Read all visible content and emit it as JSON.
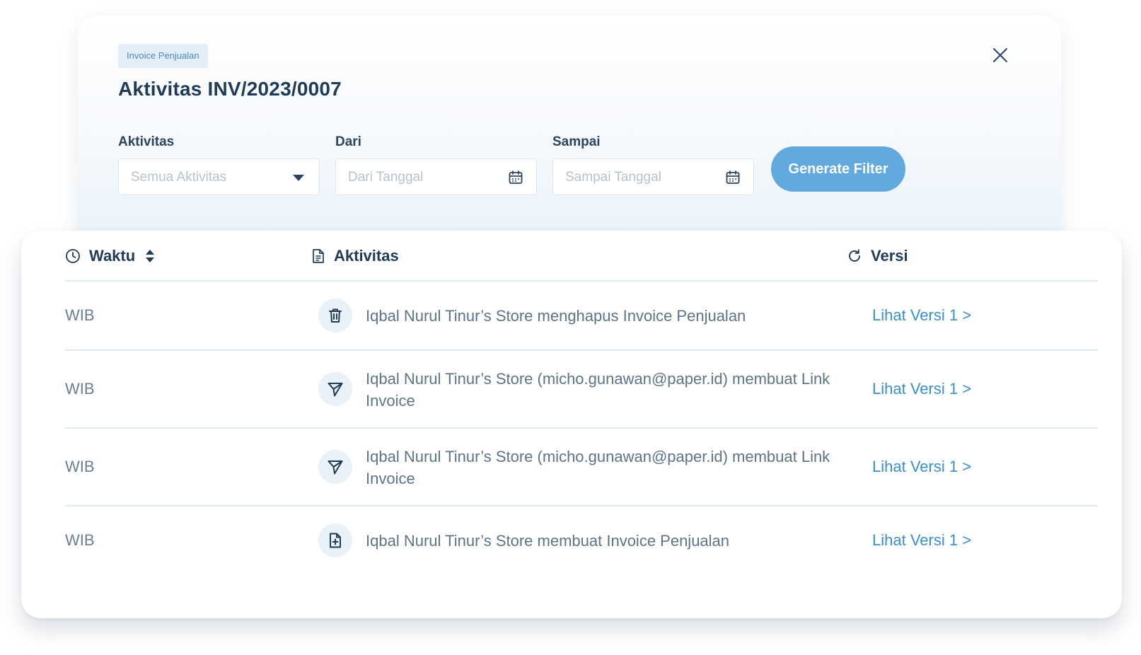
{
  "modal": {
    "badge": "Invoice Penjualan",
    "title": "Aktivitas INV/2023/0007"
  },
  "filters": {
    "activity_label": "Aktivitas",
    "activity_placeholder": "Semua Aktivitas",
    "from_label": "Dari",
    "from_placeholder": "Dari Tanggal",
    "to_label": "Sampai",
    "to_placeholder": "Sampai Tanggal",
    "generate_label": "Generate Filter"
  },
  "table": {
    "headers": {
      "time": "Waktu",
      "activity": "Aktivitas",
      "version": "Versi"
    },
    "rows": [
      {
        "time": "WIB",
        "icon": "trash-icon",
        "text": "Iqbal Nurul Tinur’s Store menghapus Invoice Penjualan",
        "version": "Lihat Versi 1 >"
      },
      {
        "time": "WIB",
        "icon": "send-icon",
        "text": "Iqbal Nurul Tinur’s Store (micho.gunawan@paper.id) membuat Link Invoice",
        "version": "Lihat Versi 1 >"
      },
      {
        "time": "WIB",
        "icon": "send-icon",
        "text": "Iqbal Nurul Tinur’s Store (micho.gunawan@paper.id) membuat Link Invoice",
        "version": "Lihat Versi 1 >"
      },
      {
        "time": "WIB",
        "icon": "file-plus-icon",
        "text": "Iqbal Nurul Tinur’s Store membuat Invoice Penjualan",
        "version": "Lihat Versi 1 >"
      }
    ]
  },
  "colors": {
    "primary": "#62a9e0",
    "link": "#3a8fd2",
    "heading": "#1f3b57",
    "muted": "#6a7f93"
  }
}
